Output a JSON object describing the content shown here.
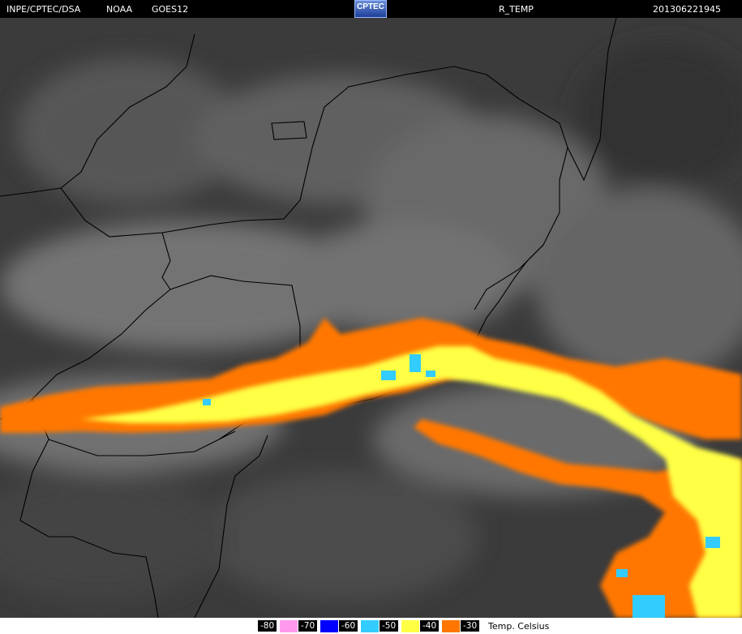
{
  "header": {
    "organization": "INPE/CPTEC/DSA",
    "agency": "NOAA",
    "satellite": "GOES12",
    "logo_text": "CPTEC",
    "product": "R_TEMP",
    "timestamp": "201306221945"
  },
  "legend": {
    "items": [
      {
        "label": "-80",
        "color": "#ff99ee"
      },
      {
        "label": "-70",
        "color": "#0000ff"
      },
      {
        "label": "-60",
        "color": "#33ccff"
      },
      {
        "label": "-50",
        "color": "#ffff44"
      },
      {
        "label": "-40",
        "color": "#ff7700"
      },
      {
        "label": "-30",
        "color": "#ff7700"
      }
    ],
    "unit": "Temp. Celsius"
  },
  "colors": {
    "background": "#3a3a3a",
    "border_lines": "#000000",
    "cold_orange": "#ff7700",
    "cold_yellow": "#ffff44",
    "cold_cyan": "#33ccff"
  }
}
